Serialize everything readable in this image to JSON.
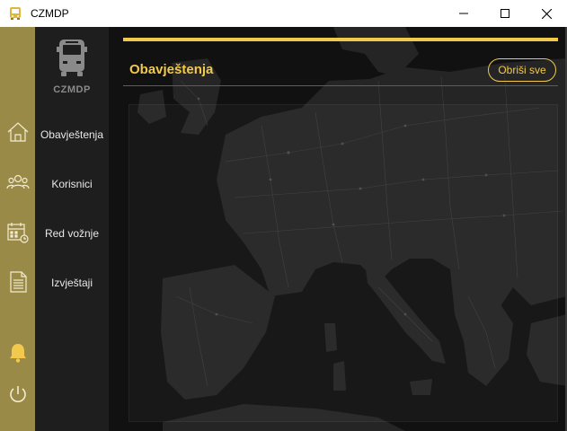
{
  "window": {
    "title": "CZMDP",
    "minimize_icon": "minimize-icon",
    "maximize_icon": "maximize-icon",
    "close_icon": "close-icon"
  },
  "rail": {
    "icons": [
      "home-icon",
      "users-icon",
      "calendar-icon",
      "document-icon",
      "bell-icon",
      "power-icon"
    ]
  },
  "logo": {
    "text": "CZMDP",
    "icon": "bus-icon"
  },
  "nav": {
    "items": [
      {
        "label": "Obavještenja"
      },
      {
        "label": "Korisnici"
      },
      {
        "label": "Red vožnje"
      },
      {
        "label": "Izvještaji"
      }
    ]
  },
  "main": {
    "title": "Obavještenja",
    "clear_all_label": "Obriši sve"
  },
  "colors": {
    "accent": "#f2c94c",
    "rail": "#9a8a48",
    "nav_bg": "#1e1e1e",
    "main_bg": "#141414"
  }
}
